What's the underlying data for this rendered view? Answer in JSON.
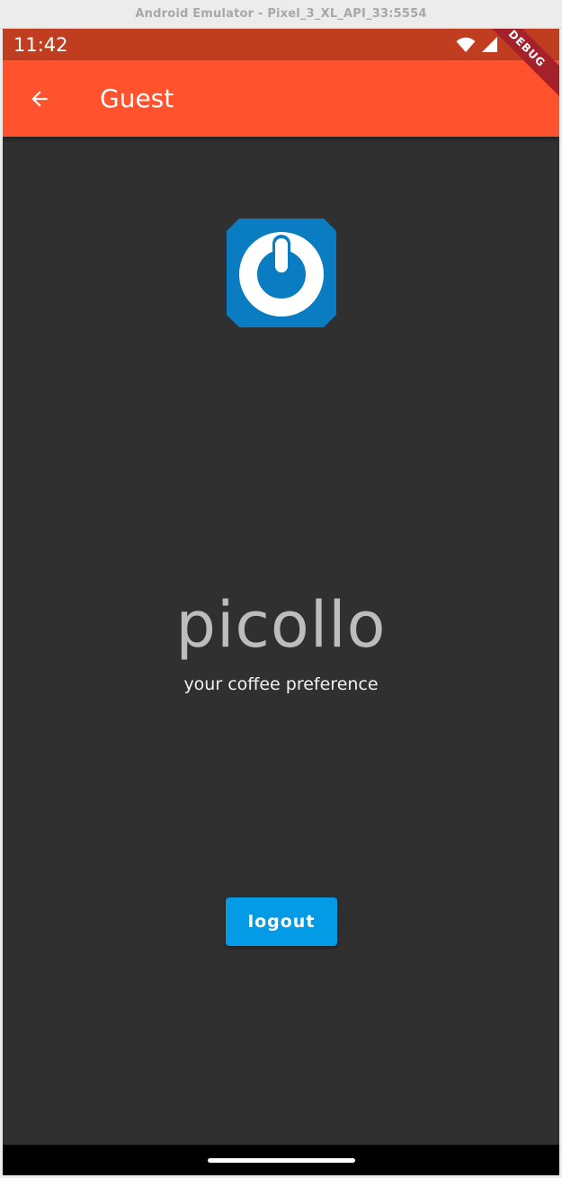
{
  "window": {
    "title": "Android Emulator - Pixel_3_XL_API_33:5554"
  },
  "status_bar": {
    "time": "11:42",
    "icons": [
      "wifi-icon",
      "signal-icon"
    ]
  },
  "debug_banner": {
    "label": "DEBUG"
  },
  "app_bar": {
    "title": "Guest",
    "back_icon": "arrow-left-icon"
  },
  "main": {
    "logo_icon": "power-logo-icon",
    "brand_name": "picollo",
    "tagline": "your coffee preference",
    "logout_label": "logout"
  },
  "colors": {
    "app_bar": "#ff522d",
    "status_bar": "#c13d1f",
    "background": "#303030",
    "button": "#039be5",
    "logo": "#0a7cc1",
    "debug_ribbon": "#a5212a"
  }
}
